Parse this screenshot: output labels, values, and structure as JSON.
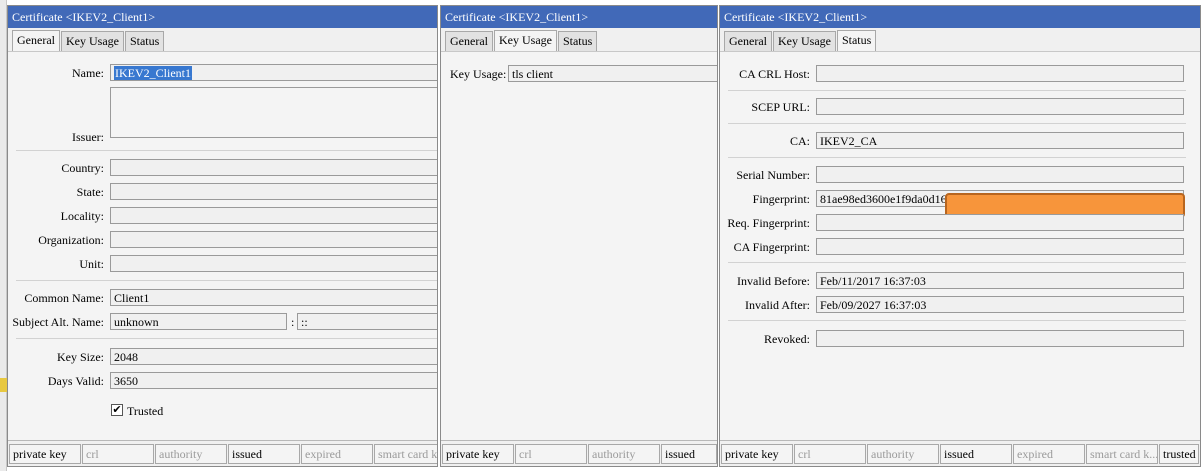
{
  "window1": {
    "title": "Certificate <IKEV2_Client1>",
    "tabs": [
      "General",
      "Key Usage",
      "Status"
    ],
    "labels": {
      "name": "Name:",
      "issuer": "Issuer:",
      "country": "Country:",
      "state": "State:",
      "locality": "Locality:",
      "organization": "Organization:",
      "unit": "Unit:",
      "common_name": "Common Name:",
      "subject_alt_name": "Subject Alt. Name:",
      "key_size": "Key Size:",
      "days_valid": "Days Valid:"
    },
    "values": {
      "name": "IKEV2_Client1",
      "common_name": "Client1",
      "subject_alt_name_type": "unknown",
      "subject_alt_name_sep": ":",
      "subject_alt_name_value": "::",
      "key_size": "2048",
      "days_valid": "3650"
    },
    "trusted_label": "Trusted",
    "trusted_checked": true,
    "checkmark": "✔",
    "status": [
      "private key",
      "crl",
      "authority",
      "issued",
      "expired",
      "smart card k..."
    ]
  },
  "window2": {
    "title": "Certificate <IKEV2_Client1>",
    "tabs": [
      "General",
      "Key Usage",
      "Status"
    ],
    "key_usage_label": "Key Usage:",
    "key_usage_value": "tls client",
    "status": [
      "private key",
      "crl",
      "authority",
      "issued"
    ]
  },
  "window3": {
    "title": "Certificate <IKEV2_Client1>",
    "tabs": [
      "General",
      "Key Usage",
      "Status"
    ],
    "labels": {
      "ca_crl_host": "CA CRL Host:",
      "scep_url": "SCEP URL:",
      "ca": "CA:",
      "serial_number": "Serial Number:",
      "fingerprint": "Fingerprint:",
      "req_fingerprint": "Req. Fingerprint:",
      "ca_fingerprint": "CA Fingerprint:",
      "invalid_before": "Invalid Before:",
      "invalid_after": "Invalid After:",
      "revoked": "Revoked:"
    },
    "values": {
      "ca": "IKEV2_CA",
      "fingerprint": "81ae98ed3600e1f9da0d16",
      "invalid_before": "Feb/11/2017 16:37:03",
      "invalid_after": "Feb/09/2027 16:37:03"
    },
    "status": [
      "private key",
      "crl",
      "authority",
      "issued",
      "expired",
      "smart card k...",
      "trusted"
    ]
  },
  "colors": {
    "titlebar": "#4169b8",
    "selection": "#3878d0",
    "redaction": "#f7953b"
  }
}
